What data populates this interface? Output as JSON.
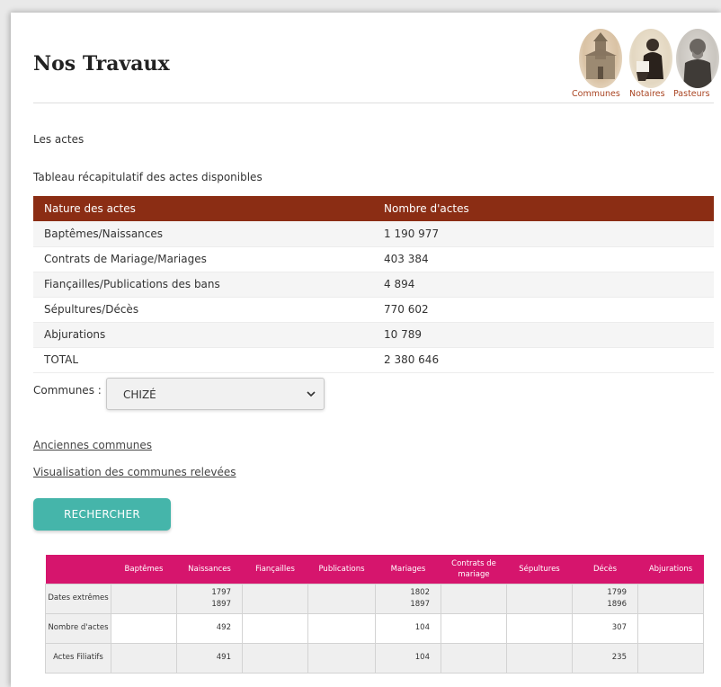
{
  "header": {
    "title": "Nos Travaux",
    "portraits": [
      {
        "label": "Communes",
        "icon": "church-icon"
      },
      {
        "label": "Notaires",
        "icon": "notary-portrait-icon"
      },
      {
        "label": "Pasteurs",
        "icon": "pastor-portrait-icon"
      }
    ]
  },
  "section": {
    "les_actes": "Les actes",
    "tableau_title": "Tableau récapitulatif des actes disponibles"
  },
  "recap": {
    "headers": [
      "Nature des actes",
      "Nombre d'actes"
    ],
    "rows": [
      [
        "Baptêmes/Naissances",
        "1 190 977"
      ],
      [
        "Contrats de Mariage/Mariages",
        "403 384"
      ],
      [
        "Fiançailles/Publications des bans",
        "4 894"
      ],
      [
        "Sépultures/Décès",
        "770 602"
      ],
      [
        "Abjurations",
        "10 789"
      ],
      [
        "TOTAL",
        "2 380 646"
      ]
    ]
  },
  "communes": {
    "label": "Communes :",
    "selected": "CHIZÉ"
  },
  "links": {
    "anciennes": "Anciennes communes",
    "visualisation": "Visualisation des communes relevées"
  },
  "search_button": "RECHERCHER",
  "detail": {
    "headers": [
      "",
      "Baptêmes",
      "Naissances",
      "Fiançailles",
      "Publications",
      "Mariages",
      "Contrats de mariage",
      "Sépultures",
      "Décès",
      "Abjurations"
    ],
    "rows": [
      {
        "label": "Dates extrêmes",
        "cells": [
          "",
          "1797\n1897",
          "",
          "",
          "1802\n1897",
          "",
          "",
          "1799\n1896",
          ""
        ]
      },
      {
        "label": "Nombre d'actes",
        "cells": [
          "",
          "492",
          "",
          "",
          "104",
          "",
          "",
          "307",
          ""
        ]
      },
      {
        "label": "Actes Filiatifs",
        "cells": [
          "",
          "491",
          "",
          "",
          "104",
          "",
          "",
          "235",
          ""
        ]
      }
    ]
  },
  "colors": {
    "recap_header": "#8b2d14",
    "detail_header": "#d6156d",
    "button": "#45b5aa",
    "portrait_label": "#a94422"
  }
}
